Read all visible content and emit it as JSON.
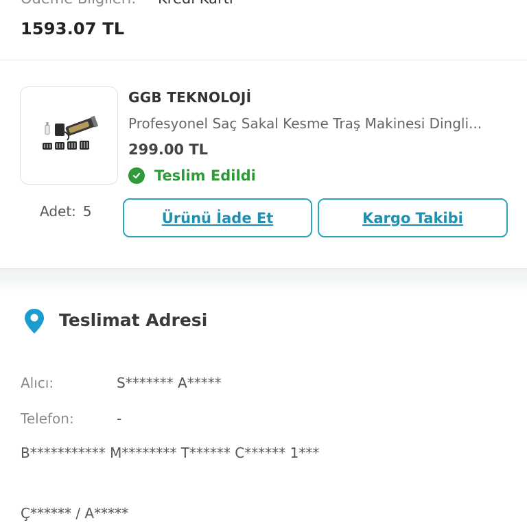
{
  "payment": {
    "label": "Ödeme Bilgileri:",
    "method": "Kredi Kartı",
    "total": "1593.07 TL"
  },
  "order_item": {
    "seller": "GGB TEKNOLOJİ",
    "product_name": "Profesyonel Saç Sakal Kesme Traş Makinesi Dingli...",
    "price": "299.00 TL",
    "status": "Teslim Edildi",
    "quantity_label": "Adet:",
    "quantity_value": "5",
    "return_button": "Ürünü İade Et",
    "cargo_button": "Kargo Takibi",
    "icons": {
      "status": "check-circle-icon",
      "product": "product-image"
    },
    "colors": {
      "status": "#2e9a3a",
      "accent": "#2aa3bc"
    }
  },
  "address": {
    "title": "Teslimat Adresi",
    "recipient_label": "Alıcı:",
    "recipient_value": "S******* A*****",
    "phone_label": "Telefon:",
    "phone_value": "-",
    "street": "B*********** M******** T****** C****** 1***",
    "city": "Ç****** /  A*****",
    "icons": {
      "pin": "location-pin-icon"
    },
    "colors": {
      "pin": "#1c9bd1"
    }
  }
}
